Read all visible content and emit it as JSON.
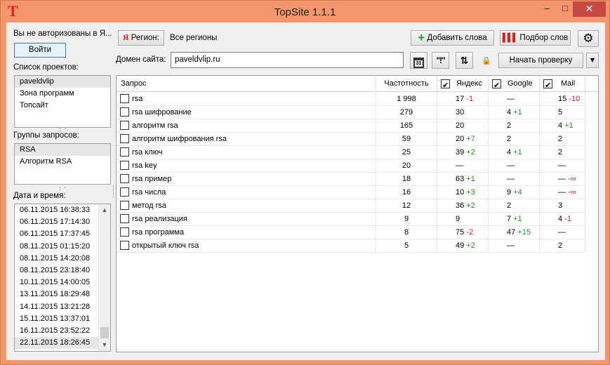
{
  "app": {
    "title": "TopSite 1.1.1",
    "logo_letter": "T"
  },
  "window_controls": {
    "minimize": "–",
    "maximize": "□",
    "close": "✕"
  },
  "auth": {
    "status_text": "Вы не авторизованы в Я...",
    "login_label": "Войти"
  },
  "projects": {
    "label": "Список проектов:",
    "items": [
      "paveldvlip",
      "Зона программ",
      "Топсайт"
    ],
    "selected": 0
  },
  "groups": {
    "label": "Группы запросов:",
    "items": [
      "RSA",
      "Алгоритм RSA"
    ],
    "selected": 0
  },
  "dates": {
    "label": "Дата и время:",
    "items": [
      "06.11.2015 16:38:33",
      "06.11.2015 17:14:30",
      "06.11.2015 17:37:45",
      "08.11.2015 01:15:20",
      "08.11.2015 14:20:08",
      "08.11.2015 23:18:40",
      "10.11.2015 14:00:05",
      "13.11.2015 18:29:48",
      "14.11.2015 13:21:28",
      "15.11.2015 13:37:01",
      "16.11.2015 23:52:22",
      "22.11.2015 18:26:45"
    ],
    "selected": 11
  },
  "toolbar": {
    "region_button": "Регион:",
    "region_value": "Все регионы",
    "add_words_label": "Добавить слова",
    "pick_words_label": "Подбор слов",
    "domain_label": "Домен сайта:",
    "domain_value": "paveldvlip.ru",
    "calendar_glyph": "31",
    "start_label": "Начать проверку"
  },
  "table": {
    "columns": {
      "query": "Запрос",
      "frequency": "Частотность",
      "yandex": "Яндекс",
      "google": "Google",
      "mail": "Mail"
    },
    "column_checked": {
      "yandex": true,
      "google": true,
      "mail": true
    },
    "rows": [
      {
        "query": "rsa",
        "freq": "1 998",
        "y": "17",
        "yd": "-1",
        "g": "—",
        "gd": "",
        "m": "15",
        "md": "-10"
      },
      {
        "query": "rsa шифрование",
        "freq": "279",
        "y": "30",
        "yd": "",
        "g": "4",
        "gd": "+1",
        "m": "5",
        "md": ""
      },
      {
        "query": "алгоритм rsa",
        "freq": "165",
        "y": "20",
        "yd": "",
        "g": "2",
        "gd": "",
        "m": "4",
        "md": "+1"
      },
      {
        "query": "алгоритм шифрования rsa",
        "freq": "59",
        "y": "20",
        "yd": "+7",
        "g": "2",
        "gd": "",
        "m": "2",
        "md": ""
      },
      {
        "query": "rsa ключ",
        "freq": "25",
        "y": "39",
        "yd": "+2",
        "g": "4",
        "gd": "+1",
        "m": "2",
        "md": ""
      },
      {
        "query": "rsa key",
        "freq": "20",
        "y": "—",
        "yd": "",
        "g": "—",
        "gd": "",
        "m": "—",
        "md": ""
      },
      {
        "query": "rsa пример",
        "freq": "18",
        "y": "63",
        "yd": "+1",
        "g": "—",
        "gd": "",
        "m": "—",
        "md": "-∞"
      },
      {
        "query": "rsa числа",
        "freq": "16",
        "y": "10",
        "yd": "+3",
        "g": "9",
        "gd": "+4",
        "m": "—",
        "md": "-∞"
      },
      {
        "query": "метод rsa",
        "freq": "12",
        "y": "36",
        "yd": "+2",
        "g": "2",
        "gd": "",
        "m": "3",
        "md": ""
      },
      {
        "query": "rsa реализация",
        "freq": "9",
        "y": "9",
        "yd": "",
        "g": "7",
        "gd": "+1",
        "m": "4",
        "md": "-1"
      },
      {
        "query": "rsa программа",
        "freq": "8",
        "y": "75",
        "yd": "-2",
        "g": "47",
        "gd": "+15",
        "m": "—",
        "md": ""
      },
      {
        "query": "открытый ключ rsa",
        "freq": "5",
        "y": "49",
        "yd": "+2",
        "g": "—",
        "gd": "",
        "m": "2",
        "md": ""
      }
    ]
  },
  "colors": {
    "frame": "#f3966c",
    "close": "#c74a45",
    "positive": "#2e8b2e",
    "negative": "#d22020"
  }
}
